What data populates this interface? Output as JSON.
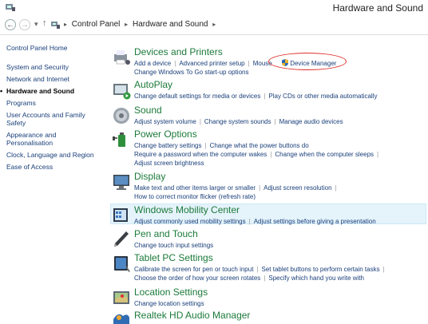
{
  "window": {
    "title": "Hardware and Sound"
  },
  "address": {
    "crumbs": [
      "Control Panel",
      "Hardware and Sound"
    ]
  },
  "sidebar": {
    "home": "Control Panel Home",
    "items": [
      {
        "label": "System and Security"
      },
      {
        "label": "Network and Internet"
      },
      {
        "label": "Hardware and Sound",
        "active": true
      },
      {
        "label": "Programs"
      },
      {
        "label": "User Accounts and Family Safety"
      },
      {
        "label": "Appearance and Personalisation"
      },
      {
        "label": "Clock, Language and Region"
      },
      {
        "label": "Ease of Access"
      }
    ]
  },
  "categories": {
    "devices": {
      "heading": "Devices and Printers",
      "links": [
        "Add a device",
        "Advanced printer setup",
        "Mouse",
        "Device Manager",
        "Change Windows To Go start-up options"
      ]
    },
    "autoplay": {
      "heading": "AutoPlay",
      "links": [
        "Change default settings for media or devices",
        "Play CDs or other media automatically"
      ]
    },
    "sound": {
      "heading": "Sound",
      "links": [
        "Adjust system volume",
        "Change system sounds",
        "Manage audio devices"
      ]
    },
    "power": {
      "heading": "Power Options",
      "links": [
        "Change battery settings",
        "Change what the power buttons do",
        "Require a password when the computer wakes",
        "Change when the computer sleeps",
        "Adjust screen brightness"
      ]
    },
    "display": {
      "heading": "Display",
      "links": [
        "Make text and other items larger or smaller",
        "Adjust screen resolution",
        "How to correct monitor flicker (refresh rate)"
      ]
    },
    "mobility": {
      "heading": "Windows Mobility Center",
      "links": [
        "Adjust commonly used mobility settings",
        "Adjust settings before giving a presentation"
      ]
    },
    "pen": {
      "heading": "Pen and Touch",
      "links": [
        "Change touch input settings"
      ]
    },
    "tablet": {
      "heading": "Tablet PC Settings",
      "links": [
        "Calibrate the screen for pen or touch input",
        "Set tablet buttons to perform certain tasks",
        "Choose the order of how your screen rotates",
        "Specify which hand you write with"
      ]
    },
    "location": {
      "heading": "Location Settings",
      "links": [
        "Change location settings"
      ]
    },
    "realtek": {
      "heading": "Realtek HD Audio Manager",
      "links": []
    }
  }
}
